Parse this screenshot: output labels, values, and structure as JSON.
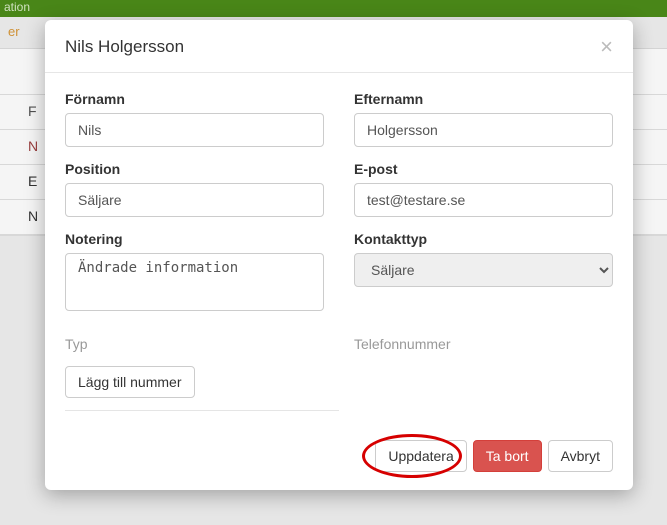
{
  "bg": {
    "header": "ation",
    "bar": "er",
    "rows": [
      "F",
      "N",
      "E",
      "N"
    ]
  },
  "modal": {
    "title": "Nils Holgersson",
    "fornamn_label": "Förnamn",
    "fornamn_value": "Nils",
    "efternamn_label": "Efternamn",
    "efternamn_value": "Holgersson",
    "position_label": "Position",
    "position_value": "Säljare",
    "epost_label": "E-post",
    "epost_value": "test@testare.se",
    "notering_label": "Notering",
    "notering_value": "Ändrade information",
    "kontakttyp_label": "Kontakttyp",
    "kontakttyp_value": "Säljare",
    "phone_typ": "Typ",
    "phone_num": "Telefonnummer",
    "add_phone": "Lägg till nummer",
    "update": "Uppdatera",
    "delete": "Ta bort",
    "cancel": "Avbryt"
  }
}
